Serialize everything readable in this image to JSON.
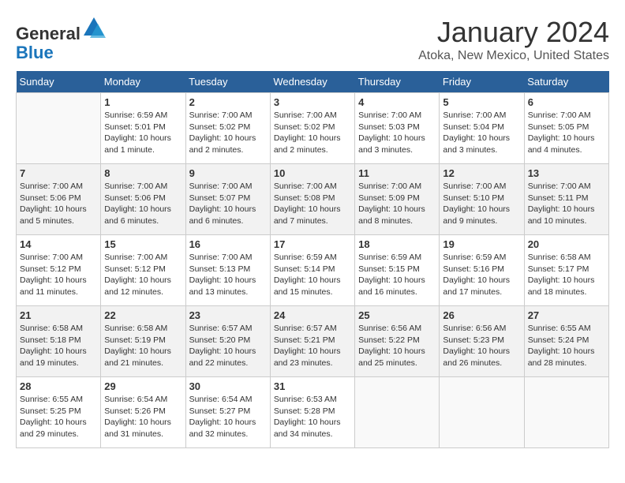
{
  "header": {
    "logo_general": "General",
    "logo_blue": "Blue",
    "month_title": "January 2024",
    "location": "Atoka, New Mexico, United States"
  },
  "days_of_week": [
    "Sunday",
    "Monday",
    "Tuesday",
    "Wednesday",
    "Thursday",
    "Friday",
    "Saturday"
  ],
  "weeks": [
    [
      {
        "day": "",
        "info": ""
      },
      {
        "day": "1",
        "info": "Sunrise: 6:59 AM\nSunset: 5:01 PM\nDaylight: 10 hours\nand 1 minute."
      },
      {
        "day": "2",
        "info": "Sunrise: 7:00 AM\nSunset: 5:02 PM\nDaylight: 10 hours\nand 2 minutes."
      },
      {
        "day": "3",
        "info": "Sunrise: 7:00 AM\nSunset: 5:02 PM\nDaylight: 10 hours\nand 2 minutes."
      },
      {
        "day": "4",
        "info": "Sunrise: 7:00 AM\nSunset: 5:03 PM\nDaylight: 10 hours\nand 3 minutes."
      },
      {
        "day": "5",
        "info": "Sunrise: 7:00 AM\nSunset: 5:04 PM\nDaylight: 10 hours\nand 3 minutes."
      },
      {
        "day": "6",
        "info": "Sunrise: 7:00 AM\nSunset: 5:05 PM\nDaylight: 10 hours\nand 4 minutes."
      }
    ],
    [
      {
        "day": "7",
        "info": "Sunrise: 7:00 AM\nSunset: 5:06 PM\nDaylight: 10 hours\nand 5 minutes."
      },
      {
        "day": "8",
        "info": "Sunrise: 7:00 AM\nSunset: 5:06 PM\nDaylight: 10 hours\nand 6 minutes."
      },
      {
        "day": "9",
        "info": "Sunrise: 7:00 AM\nSunset: 5:07 PM\nDaylight: 10 hours\nand 6 minutes."
      },
      {
        "day": "10",
        "info": "Sunrise: 7:00 AM\nSunset: 5:08 PM\nDaylight: 10 hours\nand 7 minutes."
      },
      {
        "day": "11",
        "info": "Sunrise: 7:00 AM\nSunset: 5:09 PM\nDaylight: 10 hours\nand 8 minutes."
      },
      {
        "day": "12",
        "info": "Sunrise: 7:00 AM\nSunset: 5:10 PM\nDaylight: 10 hours\nand 9 minutes."
      },
      {
        "day": "13",
        "info": "Sunrise: 7:00 AM\nSunset: 5:11 PM\nDaylight: 10 hours\nand 10 minutes."
      }
    ],
    [
      {
        "day": "14",
        "info": "Sunrise: 7:00 AM\nSunset: 5:12 PM\nDaylight: 10 hours\nand 11 minutes."
      },
      {
        "day": "15",
        "info": "Sunrise: 7:00 AM\nSunset: 5:12 PM\nDaylight: 10 hours\nand 12 minutes."
      },
      {
        "day": "16",
        "info": "Sunrise: 7:00 AM\nSunset: 5:13 PM\nDaylight: 10 hours\nand 13 minutes."
      },
      {
        "day": "17",
        "info": "Sunrise: 6:59 AM\nSunset: 5:14 PM\nDaylight: 10 hours\nand 15 minutes."
      },
      {
        "day": "18",
        "info": "Sunrise: 6:59 AM\nSunset: 5:15 PM\nDaylight: 10 hours\nand 16 minutes."
      },
      {
        "day": "19",
        "info": "Sunrise: 6:59 AM\nSunset: 5:16 PM\nDaylight: 10 hours\nand 17 minutes."
      },
      {
        "day": "20",
        "info": "Sunrise: 6:58 AM\nSunset: 5:17 PM\nDaylight: 10 hours\nand 18 minutes."
      }
    ],
    [
      {
        "day": "21",
        "info": "Sunrise: 6:58 AM\nSunset: 5:18 PM\nDaylight: 10 hours\nand 19 minutes."
      },
      {
        "day": "22",
        "info": "Sunrise: 6:58 AM\nSunset: 5:19 PM\nDaylight: 10 hours\nand 21 minutes."
      },
      {
        "day": "23",
        "info": "Sunrise: 6:57 AM\nSunset: 5:20 PM\nDaylight: 10 hours\nand 22 minutes."
      },
      {
        "day": "24",
        "info": "Sunrise: 6:57 AM\nSunset: 5:21 PM\nDaylight: 10 hours\nand 23 minutes."
      },
      {
        "day": "25",
        "info": "Sunrise: 6:56 AM\nSunset: 5:22 PM\nDaylight: 10 hours\nand 25 minutes."
      },
      {
        "day": "26",
        "info": "Sunrise: 6:56 AM\nSunset: 5:23 PM\nDaylight: 10 hours\nand 26 minutes."
      },
      {
        "day": "27",
        "info": "Sunrise: 6:55 AM\nSunset: 5:24 PM\nDaylight: 10 hours\nand 28 minutes."
      }
    ],
    [
      {
        "day": "28",
        "info": "Sunrise: 6:55 AM\nSunset: 5:25 PM\nDaylight: 10 hours\nand 29 minutes."
      },
      {
        "day": "29",
        "info": "Sunrise: 6:54 AM\nSunset: 5:26 PM\nDaylight: 10 hours\nand 31 minutes."
      },
      {
        "day": "30",
        "info": "Sunrise: 6:54 AM\nSunset: 5:27 PM\nDaylight: 10 hours\nand 32 minutes."
      },
      {
        "day": "31",
        "info": "Sunrise: 6:53 AM\nSunset: 5:28 PM\nDaylight: 10 hours\nand 34 minutes."
      },
      {
        "day": "",
        "info": ""
      },
      {
        "day": "",
        "info": ""
      },
      {
        "day": "",
        "info": ""
      }
    ]
  ]
}
